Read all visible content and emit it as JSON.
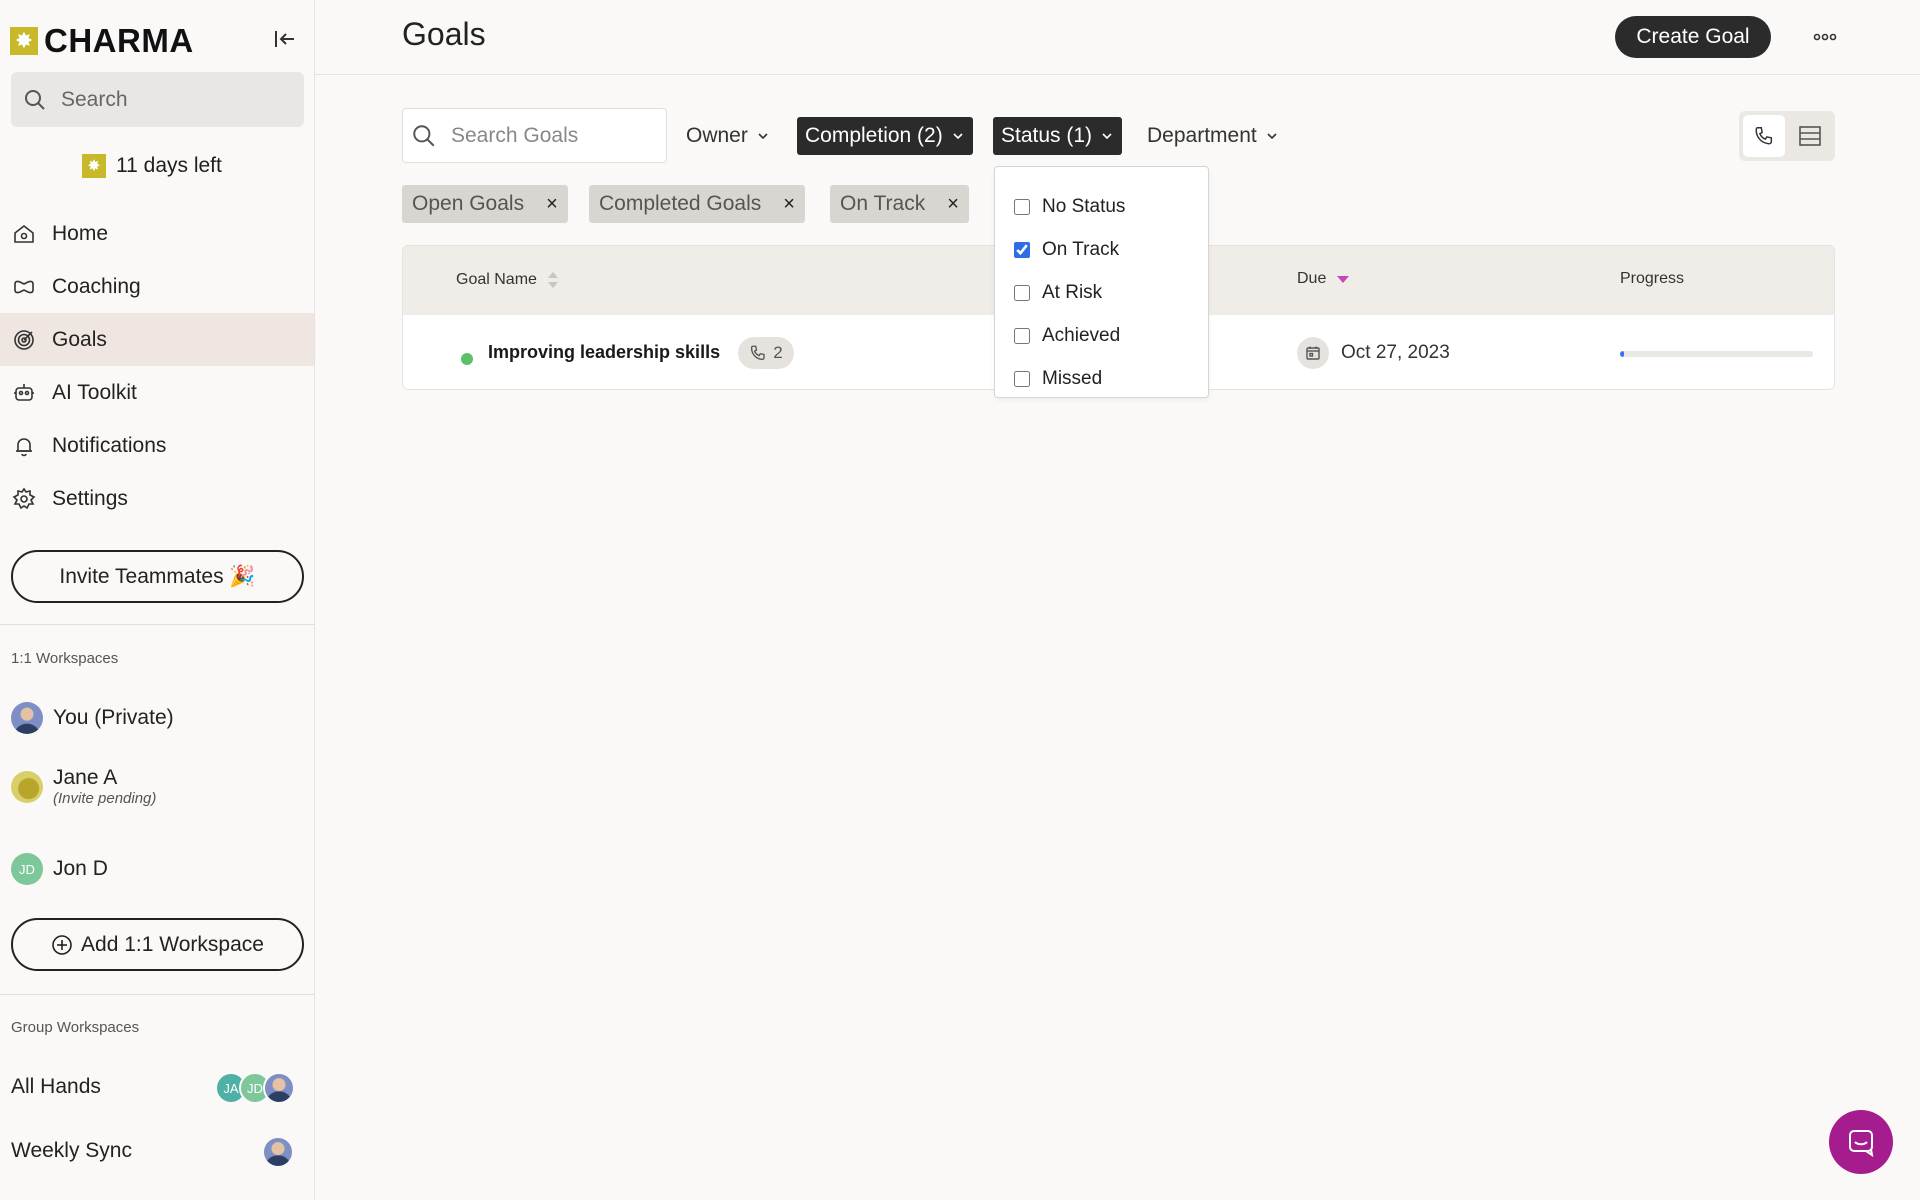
{
  "brand": {
    "name": "CHARMA",
    "mark": "✸"
  },
  "sidebar": {
    "search_label": "Search",
    "trial_text": "11 days left",
    "nav": [
      {
        "label": "Home",
        "icon": "home-icon"
      },
      {
        "label": "Coaching",
        "icon": "coaching-icon"
      },
      {
        "label": "Goals",
        "icon": "target-icon",
        "active": true
      },
      {
        "label": "AI Toolkit",
        "icon": "robot-icon"
      },
      {
        "label": "Notifications",
        "icon": "bell-icon"
      },
      {
        "label": "Settings",
        "icon": "gear-icon"
      }
    ],
    "invite_label": "Invite Teammates 🎉",
    "one_on_one_label": "1:1 Workspaces",
    "workspaces": [
      {
        "name": "You (Private)"
      },
      {
        "name": "Jane A",
        "sub": "(Invite pending)"
      },
      {
        "name": "Jon D",
        "initials": "JD"
      }
    ],
    "add_workspace_label": "Add 1:1 Workspace",
    "group_label": "Group Workspaces",
    "groups": [
      {
        "name": "All Hands",
        "avatars": [
          "JA",
          "JD"
        ]
      },
      {
        "name": "Weekly Sync"
      }
    ]
  },
  "header": {
    "title": "Goals",
    "create_label": "Create Goal"
  },
  "filters": {
    "search_placeholder": "Search Goals",
    "owner": "Owner",
    "completion": "Completion (2)",
    "status": "Status (1)",
    "department": "Department",
    "chips": [
      "Open Goals",
      "Completed Goals",
      "On Track"
    ],
    "chip_close": "×"
  },
  "table": {
    "columns": {
      "name": "Goal Name",
      "due": "Due",
      "progress": "Progress"
    },
    "rows": [
      {
        "name": "Improving leadership skills",
        "calls": "2",
        "due": "Oct 27, 2023",
        "progress": 0.02,
        "status_color": "#5cc166"
      }
    ]
  },
  "status_menu": {
    "options": [
      {
        "label": "No Status",
        "checked": false
      },
      {
        "label": "On Track",
        "checked": true
      },
      {
        "label": "At Risk",
        "checked": false
      },
      {
        "label": "Achieved",
        "checked": false
      },
      {
        "label": "Missed",
        "checked": false
      }
    ]
  },
  "colors": {
    "accent": "#c7b92a",
    "dark_button": "#2b2b2b",
    "chat": "#a51c8f",
    "progress": "#3b6ff5"
  }
}
